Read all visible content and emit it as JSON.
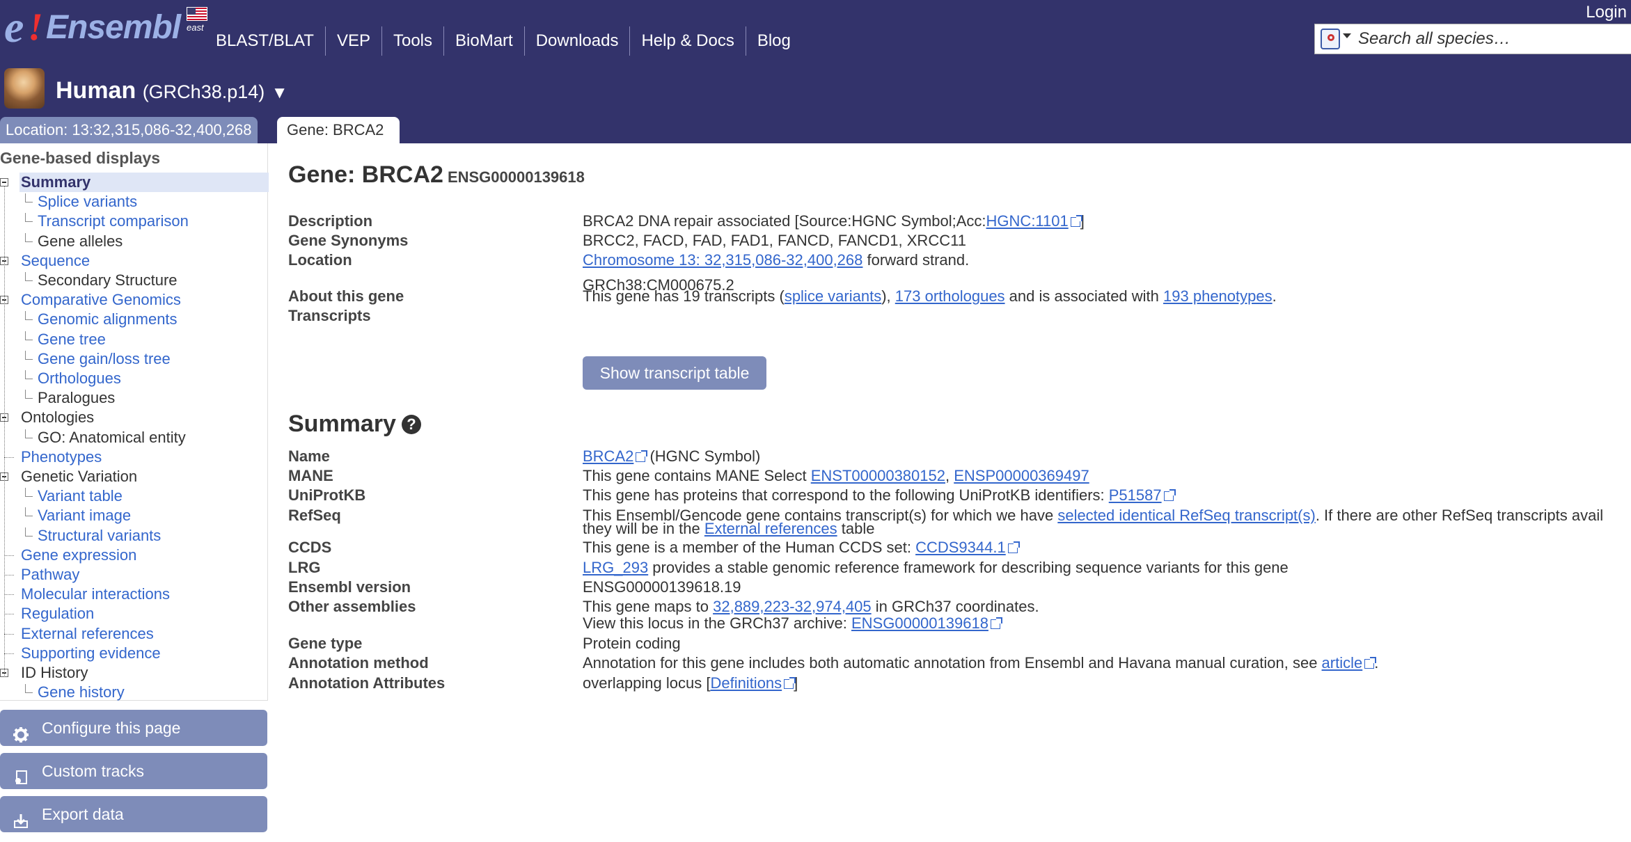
{
  "header": {
    "logo_text": "Ensembl",
    "logo_sub": "east",
    "nav": [
      "BLAST/BLAT",
      "VEP",
      "Tools",
      "BioMart",
      "Downloads",
      "Help & Docs",
      "Blog"
    ],
    "login": "Login",
    "search_placeholder": "Search all species…"
  },
  "species": {
    "name": "Human",
    "assembly": "(GRCh38.p14)",
    "dropdown": "▼"
  },
  "tabs": {
    "location": "Location: 13:32,315,086-32,400,268",
    "gene": "Gene: BRCA2"
  },
  "sidebar": {
    "heading": "Gene-based displays",
    "items": [
      {
        "label": "Summary",
        "level": 0,
        "type": "active"
      },
      {
        "label": "Splice variants",
        "level": 1,
        "type": "link"
      },
      {
        "label": "Transcript comparison",
        "level": 1,
        "type": "link"
      },
      {
        "label": "Gene alleles",
        "level": 1,
        "type": "plain"
      },
      {
        "label": "Sequence",
        "level": 0,
        "type": "link"
      },
      {
        "label": "Secondary Structure",
        "level": 1,
        "type": "plain"
      },
      {
        "label": "Comparative Genomics",
        "level": 0,
        "type": "link"
      },
      {
        "label": "Genomic alignments",
        "level": 1,
        "type": "link"
      },
      {
        "label": "Gene tree",
        "level": 1,
        "type": "link"
      },
      {
        "label": "Gene gain/loss tree",
        "level": 1,
        "type": "link"
      },
      {
        "label": "Orthologues",
        "level": 1,
        "type": "link"
      },
      {
        "label": "Paralogues",
        "level": 1,
        "type": "plain"
      },
      {
        "label": "Ontologies",
        "level": 0,
        "type": "plain"
      },
      {
        "label": "GO: Anatomical entity",
        "level": 1,
        "type": "plain"
      },
      {
        "label": "Phenotypes",
        "level": 0,
        "type": "link"
      },
      {
        "label": "Genetic Variation",
        "level": 0,
        "type": "plain"
      },
      {
        "label": "Variant table",
        "level": 1,
        "type": "link"
      },
      {
        "label": "Variant image",
        "level": 1,
        "type": "link"
      },
      {
        "label": "Structural variants",
        "level": 1,
        "type": "link"
      },
      {
        "label": "Gene expression",
        "level": 0,
        "type": "link"
      },
      {
        "label": "Pathway",
        "level": 0,
        "type": "link"
      },
      {
        "label": "Molecular interactions",
        "level": 0,
        "type": "link"
      },
      {
        "label": "Regulation",
        "level": 0,
        "type": "link"
      },
      {
        "label": "External references",
        "level": 0,
        "type": "link"
      },
      {
        "label": "Supporting evidence",
        "level": 0,
        "type": "link"
      },
      {
        "label": "ID History",
        "level": 0,
        "type": "plain"
      },
      {
        "label": "Gene history",
        "level": 1,
        "type": "link"
      }
    ],
    "buttons": [
      "Configure this page",
      "Custom tracks",
      "Export data"
    ]
  },
  "gene": {
    "title": "Gene: BRCA2",
    "stable_id": "ENSG00000139618",
    "description": {
      "label": "Description",
      "text": "BRCA2 DNA repair associated [Source:HGNC Symbol;Acc:",
      "link": "HGNC:1101",
      "end": "]"
    },
    "synonyms": {
      "label": "Gene Synonyms",
      "text": "BRCC2, FACD, FAD, FAD1, FANCD, FANCD1, XRCC11"
    },
    "location": {
      "label": "Location",
      "link": "Chromosome 13: 32,315,086-32,400,268",
      "text": " forward strand.",
      "line2": "GRCh38:CM000675.2"
    },
    "about": {
      "label": "About this gene",
      "t1": "This gene has 19 transcripts (",
      "l1": "splice variants",
      "t2": "), ",
      "l2": "173 orthologues",
      "t3": " and is associated with ",
      "l3": "193 phenotypes",
      "t4": "."
    },
    "transcripts": {
      "label": "Transcripts",
      "button": "Show transcript table"
    }
  },
  "summary": {
    "heading": "Summary",
    "name": {
      "label": "Name",
      "link": "BRCA2",
      "text": " (HGNC Symbol)"
    },
    "mane": {
      "label": "MANE",
      "text": "This gene contains MANE Select ",
      "l1": "ENST00000380152",
      "sep": ", ",
      "l2": "ENSP00000369497"
    },
    "uniprot": {
      "label": "UniProtKB",
      "text": "This gene has proteins that correspond to the following UniProtKB identifiers: ",
      "link": "P51587"
    },
    "refseq": {
      "label": "RefSeq",
      "t1": "This Ensembl/Gencode gene contains transcript(s) for which we have ",
      "l1": "selected identical RefSeq transcript(s)",
      "t2": ". If there are other RefSeq transcripts avail",
      "t3": "they will be in the ",
      "l2": "External references",
      "t4": " table"
    },
    "ccds": {
      "label": "CCDS",
      "text": "This gene is a member of the Human CCDS set: ",
      "link": "CCDS9344.1"
    },
    "lrg": {
      "label": "LRG",
      "link": "LRG_293",
      "text": " provides a stable genomic reference framework for describing sequence variants for this gene"
    },
    "version": {
      "label": "Ensembl version",
      "text": "ENSG00000139618.19"
    },
    "other": {
      "label": "Other assemblies",
      "t1": "This gene maps to ",
      "l1": "32,889,223-32,974,405",
      "t2": " in GRCh37 coordinates.",
      "t3": "View this locus in the GRCh37 archive: ",
      "l2": "ENSG00000139618"
    },
    "gene_type": {
      "label": "Gene type",
      "text": "Protein coding"
    },
    "annotation": {
      "label": "Annotation method",
      "text": "Annotation for this gene includes both automatic annotation from Ensembl and Havana manual curation, see ",
      "link": "article",
      "end": "."
    },
    "attributes": {
      "label": "Annotation Attributes",
      "text": "overlapping locus [",
      "link": "Definitions",
      "end": "]"
    }
  }
}
